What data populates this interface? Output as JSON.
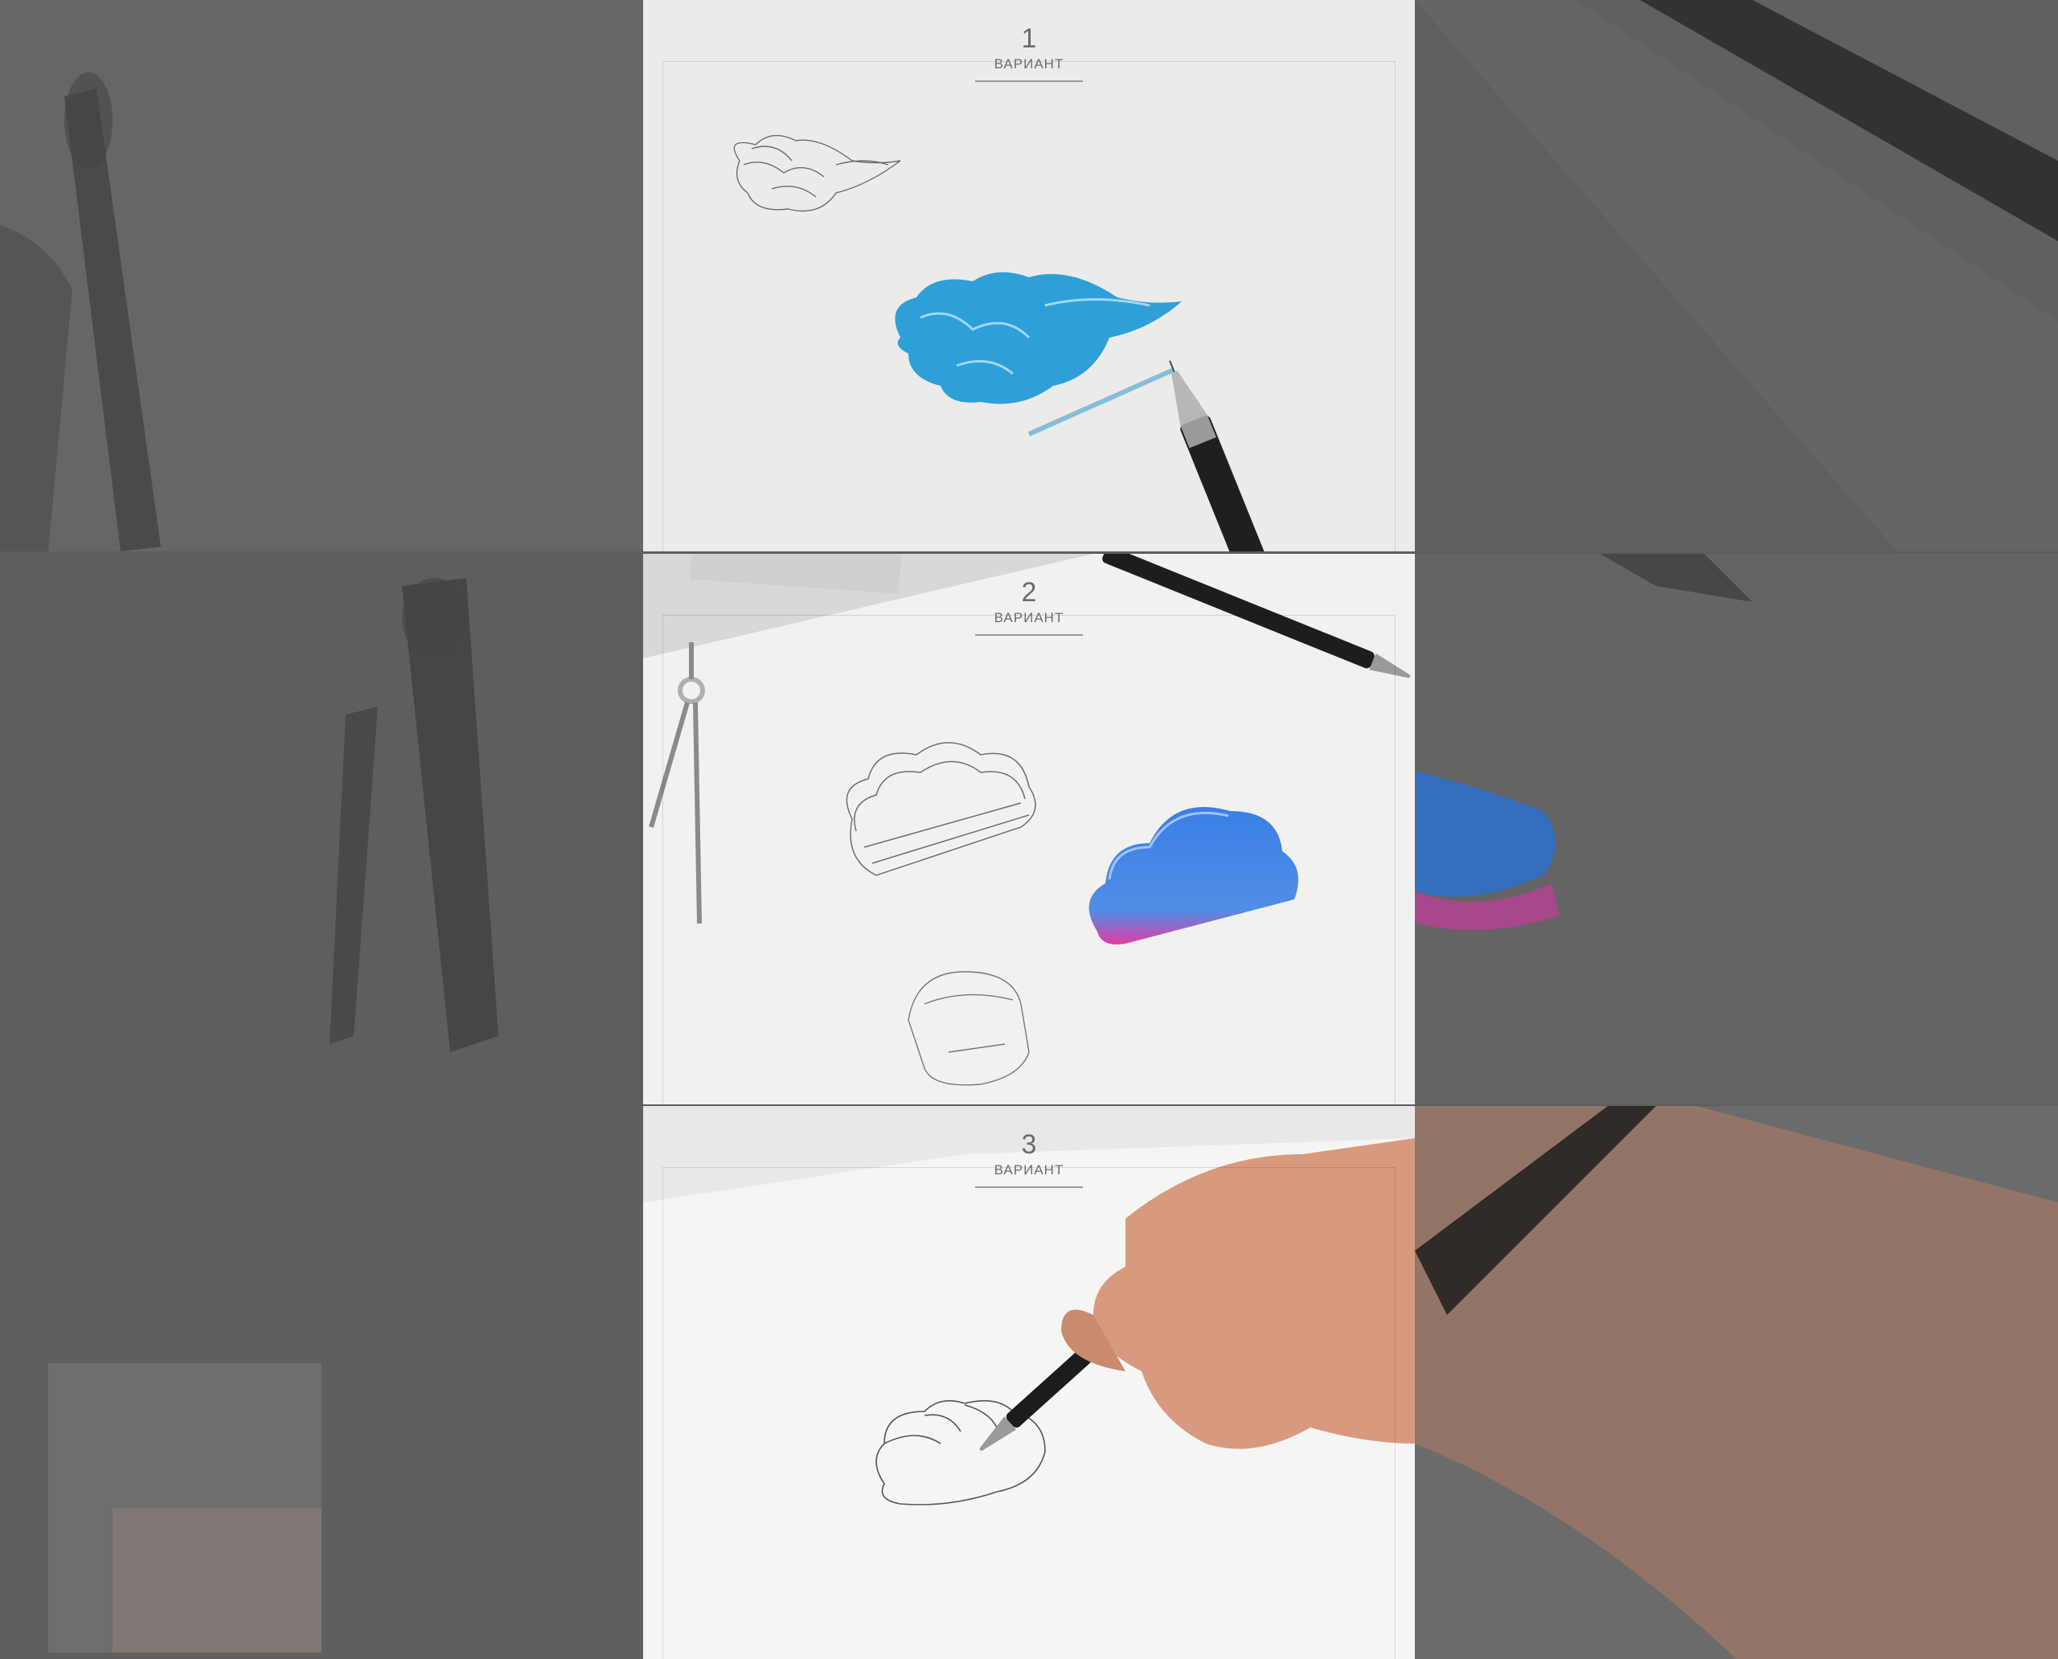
{
  "variants": [
    {
      "number": "1",
      "label": "ВАРИАНТ"
    },
    {
      "number": "2",
      "label": "ВАРИАНТ"
    },
    {
      "number": "3",
      "label": "ВАРИАНТ"
    }
  ],
  "colors": {
    "paper": "#ececea",
    "blue_sketch": "#2e9fd8",
    "gradient_blue": "#3b7fe6",
    "gradient_pink": "#e23ca6",
    "pencil": "#222222"
  }
}
